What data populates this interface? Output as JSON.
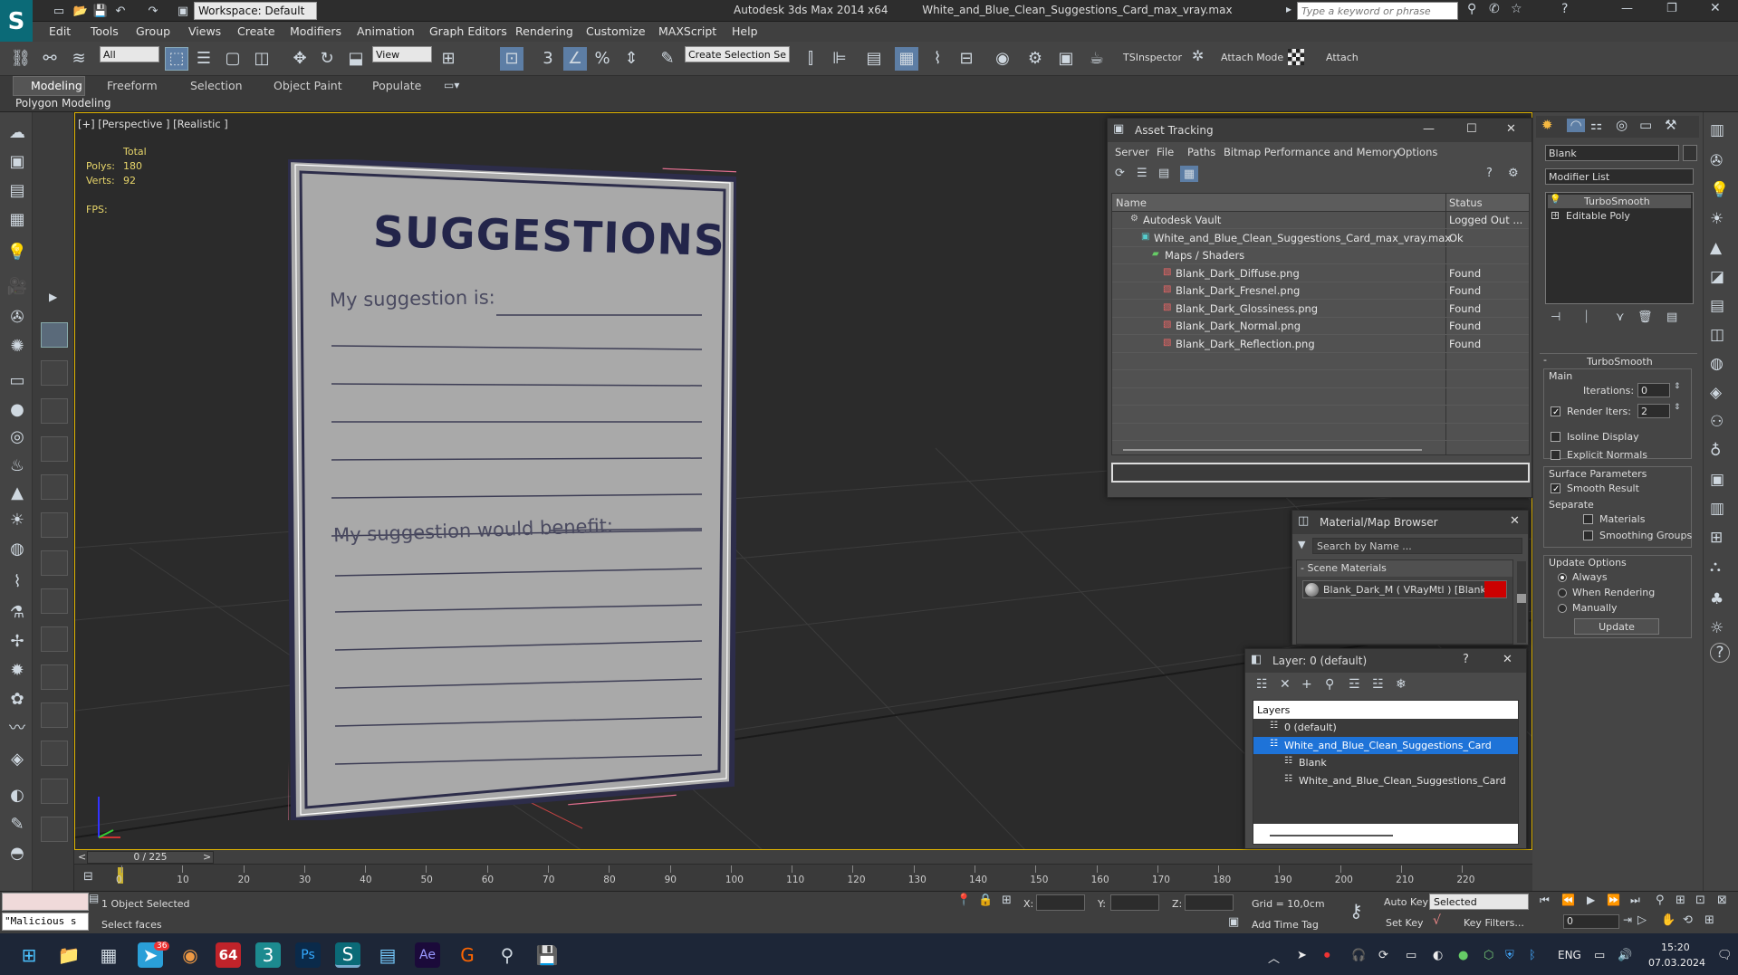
{
  "titlebar": {
    "workspace": "Workspace: Default",
    "app": "Autodesk 3ds Max  2014 x64",
    "file": "White_and_Blue_Clean_Suggestions_Card_max_vray.max",
    "search_placeholder": "Type a keyword or phrase"
  },
  "menu": [
    "Edit",
    "Tools",
    "Group",
    "Views",
    "Create",
    "Modifiers",
    "Animation",
    "Graph Editors",
    "Rendering",
    "Customize",
    "MAXScript",
    "Help"
  ],
  "toolbar": {
    "selection_filter": "All",
    "ref_coord": "View",
    "selection_set": "Create Selection Se",
    "tsinspector": "TSInspector",
    "attach_mode": "Attach Mode",
    "attach": "Attach"
  },
  "ribbon": {
    "tabs": [
      "Modeling",
      "Freeform",
      "Selection",
      "Object Paint",
      "Populate"
    ],
    "active": "Modeling",
    "sub": "Polygon Modeling"
  },
  "viewport": {
    "label": "[+] [Perspective ] [Realistic ]",
    "stats": {
      "total": "Total",
      "polys_label": "Polys:",
      "polys": "180",
      "verts_label": "Verts:",
      "verts": "92",
      "fps": "FPS:"
    },
    "card": {
      "title": "SUGGESTIONS",
      "line1": "My suggestion is:",
      "line2": "My suggestion would benefit:"
    }
  },
  "asset_tracking": {
    "title": "Asset Tracking",
    "menu": [
      "Server",
      "File",
      "Paths",
      "Bitmap Performance and Memory",
      "Options"
    ],
    "col_name": "Name",
    "col_status": "Status",
    "rows": [
      {
        "name": "Autodesk Vault",
        "status": "Logged Out ...",
        "indent": 0,
        "icon": "vault"
      },
      {
        "name": "White_and_Blue_Clean_Suggestions_Card_max_vray.max",
        "status": "Ok",
        "indent": 1,
        "icon": "max"
      },
      {
        "name": "Maps / Shaders",
        "status": "",
        "indent": 2,
        "icon": "maps"
      },
      {
        "name": "Blank_Dark_Diffuse.png",
        "status": "Found",
        "indent": 3,
        "icon": "png"
      },
      {
        "name": "Blank_Dark_Fresnel.png",
        "status": "Found",
        "indent": 3,
        "icon": "png"
      },
      {
        "name": "Blank_Dark_Glossiness.png",
        "status": "Found",
        "indent": 3,
        "icon": "png"
      },
      {
        "name": "Blank_Dark_Normal.png",
        "status": "Found",
        "indent": 3,
        "icon": "png"
      },
      {
        "name": "Blank_Dark_Reflection.png",
        "status": "Found",
        "indent": 3,
        "icon": "png"
      }
    ]
  },
  "material_browser": {
    "title": "Material/Map Browser",
    "search": "Search by Name ...",
    "section": "- Scene Materials",
    "item": "Blank_Dark_M  ( VRayMtl )  [Blank]"
  },
  "layer_dialog": {
    "title": "Layer: 0 (default)",
    "header": "Layers",
    "rows": [
      {
        "name": "0 (default)",
        "indent": 0,
        "selected": false
      },
      {
        "name": "White_and_Blue_Clean_Suggestions_Card",
        "indent": 0,
        "selected": true
      },
      {
        "name": "Blank",
        "indent": 1,
        "selected": false
      },
      {
        "name": "White_and_Blue_Clean_Suggestions_Card",
        "indent": 1,
        "selected": false
      }
    ]
  },
  "command_panel": {
    "object_name": "Blank",
    "modifier_list": "Modifier List",
    "stack": [
      "TurboSmooth",
      "Editable Poly"
    ],
    "rollout": "TurboSmooth",
    "main": "Main",
    "iterations_label": "Iterations:",
    "iterations": "0",
    "render_iters_label": "Render Iters:",
    "render_iters": "2",
    "isoline": "Isoline Display",
    "explicit_normals": "Explicit Normals",
    "surface_params": "Surface Parameters",
    "smooth_result": "Smooth Result",
    "separate": "Separate",
    "materials": "Materials",
    "smoothing_groups": "Smoothing Groups",
    "update_options": "Update Options",
    "always": "Always",
    "when_rendering": "When Rendering",
    "manually": "Manually",
    "update": "Update"
  },
  "timeline": {
    "frame": "0 / 225",
    "ticks": [
      "0",
      "10",
      "20",
      "30",
      "40",
      "50",
      "60",
      "70",
      "80",
      "90",
      "100",
      "110",
      "120",
      "130",
      "140",
      "150",
      "160",
      "170",
      "180",
      "190",
      "200",
      "210",
      "220"
    ]
  },
  "status": {
    "script": "\"Malicious s",
    "selected": "1 Object Selected",
    "prompt": "Select faces",
    "x": "X:",
    "y": "Y:",
    "z": "Z:",
    "grid": "Grid = 10,0cm",
    "add_time_tag": "Add Time Tag",
    "auto_key": "Auto Key",
    "set_key": "Set Key",
    "key_mode": "Selected",
    "key_filters": "Key Filters...",
    "frame_value": "0"
  },
  "taskbar": {
    "lang": "ENG",
    "time": "15:20",
    "date": "07.03.2024",
    "badge": "36",
    "num_app": "64"
  }
}
